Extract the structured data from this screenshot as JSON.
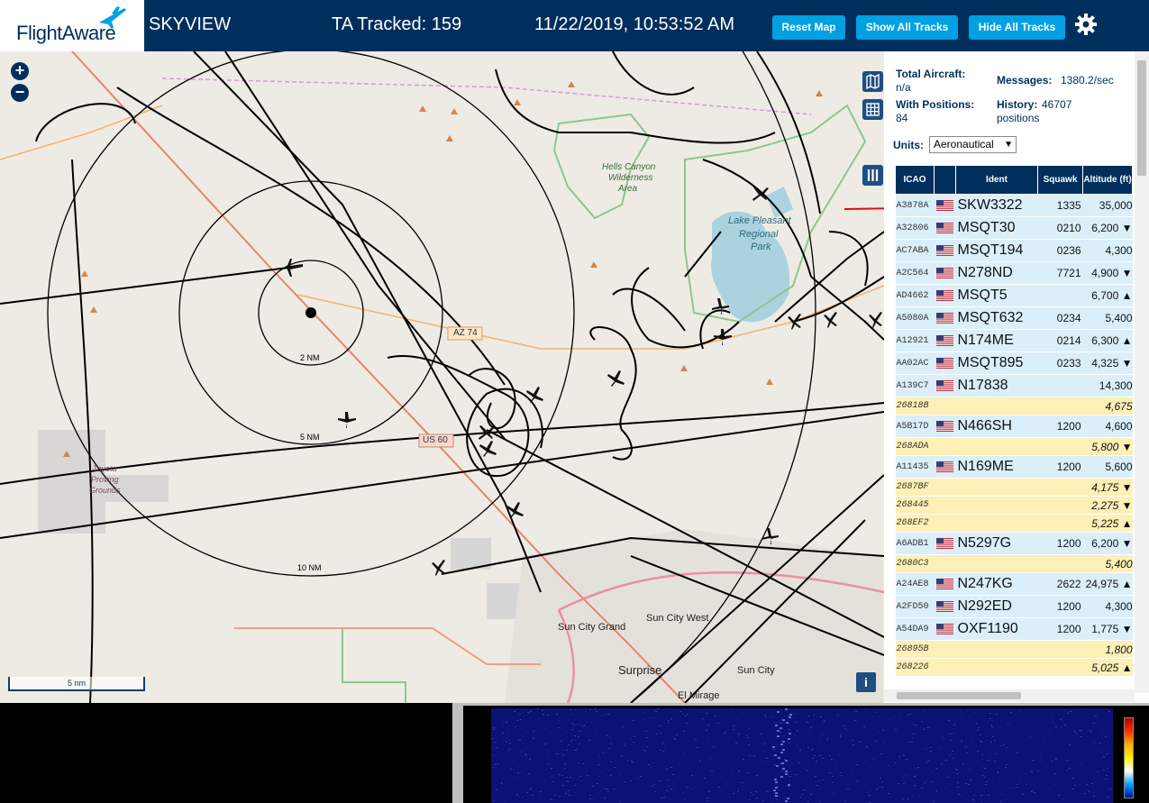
{
  "header": {
    "logo_text": "FlightAware",
    "site_name": "SKYVIEW",
    "tracked": "TA Tracked: 159",
    "datetime": "11/22/2019, 10:53:52 AM",
    "buttons": {
      "reset": "Reset Map",
      "show": "Show All Tracks",
      "hide": "Hide All Tracks"
    }
  },
  "map": {
    "zoom_in": "+",
    "zoom_out": "−",
    "scale": "5 nm",
    "info": "i",
    "range_labels": [
      "2 NM",
      "5 NM",
      "10 NM"
    ],
    "place_labels": [
      "Hells Canyon",
      "Wilderness",
      "Area",
      "Lake Pleasant",
      "Regional",
      "Park",
      "Toyota",
      "Proving",
      "Grounds",
      "Sun City Grand",
      "Sun City West",
      "Surprise",
      "Sun City",
      "El Mirage"
    ],
    "road_labels": [
      "AZ 74",
      "US 60"
    ],
    "colors": {
      "water": "#aad3df",
      "park_border": "#8fc58f",
      "road": "#f4a460",
      "highway": "#e8846f",
      "track": "#000000"
    }
  },
  "panel": {
    "total_aircraft_label": "Total Aircraft:",
    "total_aircraft": "n/a",
    "with_positions_label": "With Positions:",
    "with_positions": "84",
    "messages_label": "Messages:",
    "messages": "1380.2/sec",
    "history_label": "History:",
    "history": "46707",
    "history_unit": "positions",
    "units_label": "Units:",
    "units_value": "Aeronautical",
    "columns": [
      "ICAO",
      "",
      "Ident",
      "Squawk",
      "Altitude (ft)"
    ],
    "rows": [
      {
        "icao": "A3878A",
        "flag": true,
        "ident": "SKW3322",
        "squawk": "1335",
        "alt": "35,000",
        "pos": true
      },
      {
        "icao": "A32806",
        "flag": true,
        "ident": "MSQT30",
        "squawk": "0210",
        "alt": "6,200 ▼",
        "pos": true
      },
      {
        "icao": "AC7ABA",
        "flag": true,
        "ident": "MSQT194",
        "squawk": "0236",
        "alt": "4,300",
        "pos": true
      },
      {
        "icao": "A2C564",
        "flag": true,
        "ident": "N278ND",
        "squawk": "7721",
        "alt": "4,900 ▼",
        "pos": true
      },
      {
        "icao": "AD4662",
        "flag": true,
        "ident": "MSQT5",
        "squawk": "",
        "alt": "6,700 ▲",
        "pos": true
      },
      {
        "icao": "A5080A",
        "flag": true,
        "ident": "MSQT632",
        "squawk": "0234",
        "alt": "5,400",
        "pos": true
      },
      {
        "icao": "A12921",
        "flag": true,
        "ident": "N174ME",
        "squawk": "0214",
        "alt": "6,300 ▲",
        "pos": true
      },
      {
        "icao": "AA02AC",
        "flag": true,
        "ident": "MSQT895",
        "squawk": "0233",
        "alt": "4,325 ▼",
        "pos": true
      },
      {
        "icao": "A139C7",
        "flag": true,
        "ident": "N17838",
        "squawk": "",
        "alt": "14,300",
        "pos": true
      },
      {
        "icao": "26818B",
        "flag": false,
        "ident": "",
        "squawk": "",
        "alt": "4,675",
        "pos": false
      },
      {
        "icao": "A5B17D",
        "flag": true,
        "ident": "N466SH",
        "squawk": "1200",
        "alt": "4,600",
        "pos": true
      },
      {
        "icao": "268ADA",
        "flag": false,
        "ident": "",
        "squawk": "",
        "alt": "5,800 ▼",
        "pos": false
      },
      {
        "icao": "A11435",
        "flag": true,
        "ident": "N169ME",
        "squawk": "1200",
        "alt": "5,600",
        "pos": true
      },
      {
        "icao": "2687BF",
        "flag": false,
        "ident": "",
        "squawk": "",
        "alt": "4,175 ▼",
        "pos": false
      },
      {
        "icao": "268445",
        "flag": false,
        "ident": "",
        "squawk": "",
        "alt": "2,275 ▼",
        "pos": false
      },
      {
        "icao": "268EF2",
        "flag": false,
        "ident": "",
        "squawk": "",
        "alt": "5,225 ▲",
        "pos": false
      },
      {
        "icao": "A6ADB1",
        "flag": true,
        "ident": "N5297G",
        "squawk": "1200",
        "alt": "6,200 ▼",
        "pos": true
      },
      {
        "icao": "2680C3",
        "flag": false,
        "ident": "",
        "squawk": "",
        "alt": "5,400",
        "pos": false
      },
      {
        "icao": "A24AE8",
        "flag": true,
        "ident": "N247KG",
        "squawk": "2622",
        "alt": "24,975 ▲",
        "pos": true
      },
      {
        "icao": "A2FD50",
        "flag": true,
        "ident": "N292ED",
        "squawk": "1200",
        "alt": "4,300",
        "pos": true
      },
      {
        "icao": "A54DA9",
        "flag": true,
        "ident": "OXF1190",
        "squawk": "1200",
        "alt": "1,775 ▼",
        "pos": true
      },
      {
        "icao": "26895B",
        "flag": false,
        "ident": "",
        "squawk": "",
        "alt": "1,800",
        "pos": false
      },
      {
        "icao": "268226",
        "flag": false,
        "ident": "",
        "squawk": "",
        "alt": "5,025 ▲",
        "pos": false
      }
    ]
  }
}
